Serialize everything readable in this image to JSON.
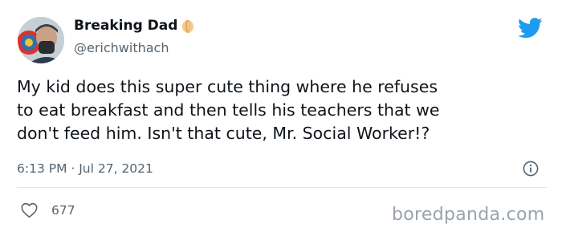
{
  "tweet": {
    "author": {
      "display_name": "Breaking Dad",
      "handle": "@erichwithach"
    },
    "text_lines": [
      "My kid does this super cute thing where he refuses",
      "to eat breakfast and then tells his teachers that we",
      "don't feed him. Isn't that cute, Mr. Social Worker!?"
    ],
    "timestamp": "6:13 PM · Jul 27, 2021",
    "likes": "677"
  },
  "icons": {
    "brand": "twitter-bird-icon",
    "info": "info-icon",
    "like": "heart-icon",
    "badge_emoji": "peach-emoji-icon"
  },
  "colors": {
    "twitter_blue": "#1d9bf0",
    "text_primary": "#0f1419",
    "text_secondary": "#536471"
  },
  "watermark": "boredpanda.com"
}
